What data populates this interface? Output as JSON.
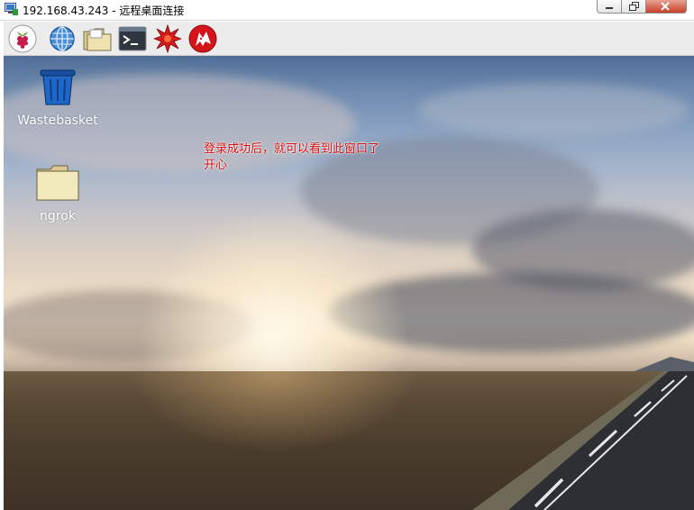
{
  "window": {
    "title": "192.168.43.243 - 远程桌面连接",
    "minimize_icon": "minimize-icon",
    "restore_icon": "restore-icon",
    "close_icon": "close-icon"
  },
  "panel": {
    "launchers": [
      {
        "name": "raspberry-menu",
        "icon": "raspberry-icon"
      },
      {
        "name": "web-browser",
        "icon": "globe-icon"
      },
      {
        "name": "file-manager",
        "icon": "folder-icon"
      },
      {
        "name": "terminal",
        "icon": "terminal-icon"
      },
      {
        "name": "mathematica",
        "icon": "starburst-icon"
      },
      {
        "name": "wolfram",
        "icon": "wolf-icon"
      }
    ]
  },
  "desktop": {
    "icons": [
      {
        "label": "Wastebasket",
        "icon": "trash-icon"
      },
      {
        "label": "ngrok",
        "icon": "folder-icon"
      }
    ],
    "annotation": {
      "line1": "登录成功后，就可以看到此窗口了",
      "line2": "开心",
      "color": "#d01010"
    }
  }
}
